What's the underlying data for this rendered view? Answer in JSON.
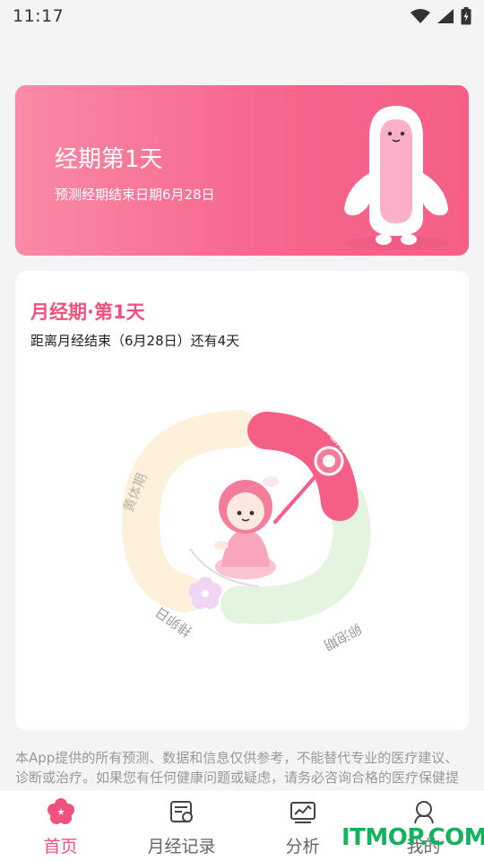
{
  "status_bar": {
    "time": "11:17"
  },
  "hero": {
    "title": "经期第1天",
    "subtitle": "预测经期结束日期6月28日"
  },
  "cycle": {
    "title": "月经期·第1天",
    "subtitle": "距离月经结束（6月28日）还有4天",
    "phases": {
      "menstrual": "月经期",
      "follicular": "卵泡期",
      "ovulation": "排卵日",
      "luteal": "黄体期"
    },
    "colors": {
      "menstrual": "#f55f86",
      "follicular": "#e3f5df",
      "luteal": "#fdf1dc",
      "ovulation_flower": "#f1d6f4"
    }
  },
  "disclaimer": "本App提供的所有预测、数据和信息仅供参考，不能替代专业的医疗建议、诊断或治疗。如果您有任何健康问题或疑虑，请务必咨询合格的医疗保健提供者。对于因使用或依赖本App内容而导致的任何后果，本App概不负责。",
  "tabs": [
    {
      "label": "首页",
      "icon": "flower-icon",
      "active": true
    },
    {
      "label": "月经记录",
      "icon": "calendar-record-icon",
      "active": false
    },
    {
      "label": "分析",
      "icon": "chart-icon",
      "active": false
    },
    {
      "label": "我的",
      "icon": "profile-icon",
      "active": false
    }
  ],
  "watermark": "ITMOP.COM",
  "accent_color": "#f0527e"
}
